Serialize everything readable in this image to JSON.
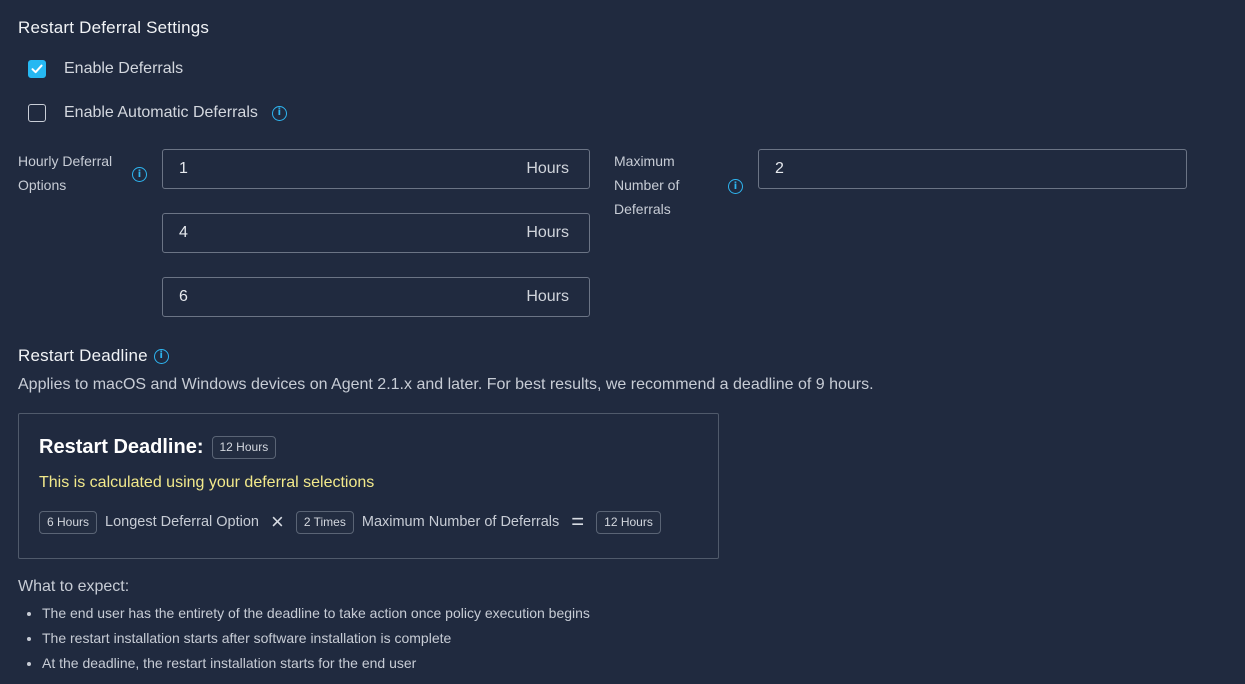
{
  "section_title": "Restart Deferral Settings",
  "enable_deferrals": {
    "label": "Enable Deferrals",
    "checked": true
  },
  "enable_automatic_deferrals": {
    "label": "Enable Automatic Deferrals",
    "checked": false
  },
  "hourly_options": {
    "label_line1": "Hourly Deferral",
    "label_line2": "Options",
    "items": [
      {
        "value": "1",
        "unit": "Hours"
      },
      {
        "value": "4",
        "unit": "Hours"
      },
      {
        "value": "6",
        "unit": "Hours"
      }
    ]
  },
  "max_deferrals": {
    "label_line1": "Maximum",
    "label_line2": "Number of",
    "label_line3": "Deferrals",
    "value": "2"
  },
  "deadline": {
    "title": "Restart Deadline",
    "description": "Applies to macOS and Windows devices on Agent 2.1.x and later. For best results, we recommend a deadline of 9 hours.",
    "card_title": "Restart Deadline:",
    "card_badge": "12 Hours",
    "calc_note": "This is calculated using your deferral selections",
    "formula": {
      "badge1": "6 Hours",
      "label1": "Longest Deferral Option",
      "op1": "×",
      "badge2": "2 Times",
      "label2": "Maximum Number of Deferrals",
      "op2": "=",
      "badge3": "12 Hours"
    }
  },
  "expect": {
    "title": "What to expect:",
    "items": [
      "The end user has the entirety of the deadline to take action once policy execution begins",
      "The restart installation starts after software installation is complete",
      "At the deadline, the restart installation starts for the end user"
    ]
  },
  "colors": {
    "accent": "#26b8f2",
    "background": "#202a3f",
    "note": "#f2e98b"
  }
}
